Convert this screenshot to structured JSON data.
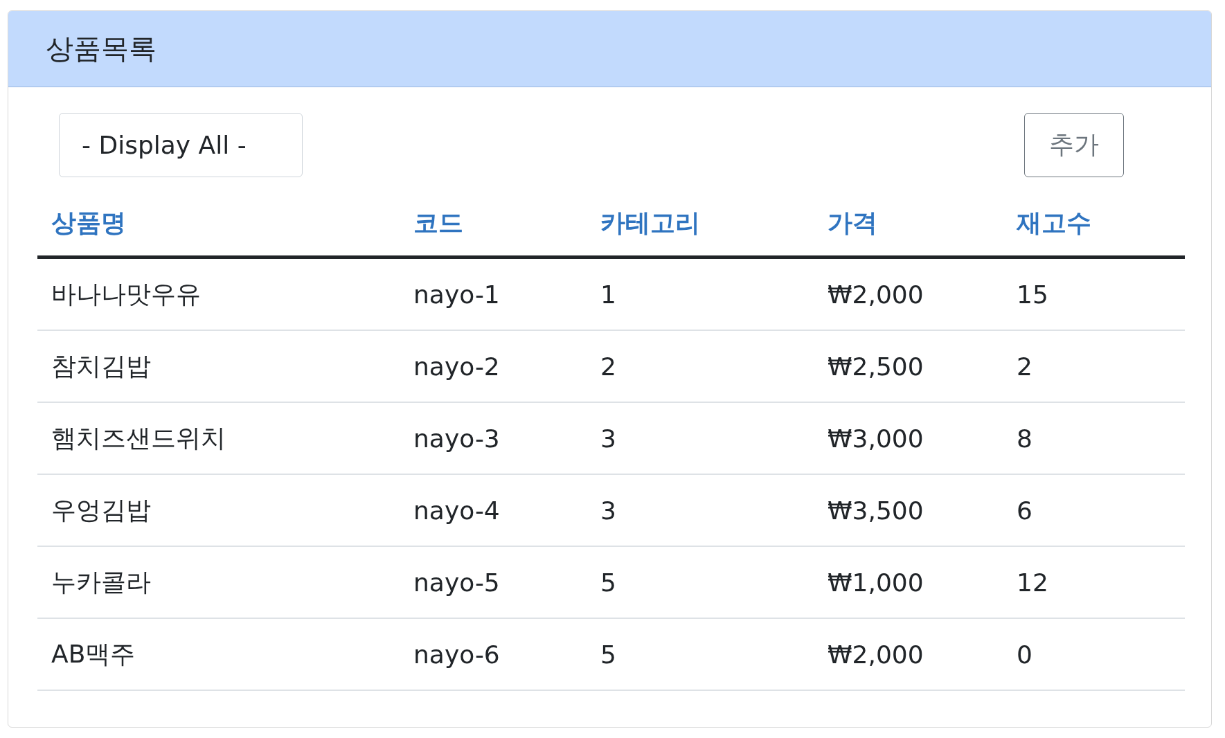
{
  "card": {
    "title": "상품목록"
  },
  "filter": {
    "value": "- Display All -"
  },
  "add_button": {
    "label": "추가"
  },
  "table": {
    "columns": [
      "상품명",
      "코드",
      "카테고리",
      "가격",
      "재고수"
    ],
    "rows": [
      [
        "바나나맛우유",
        "nayo-1",
        "1",
        "₩2,000",
        "15"
      ],
      [
        "참치김밥",
        "nayo-2",
        "2",
        "₩2,500",
        "2"
      ],
      [
        "햄치즈샌드위치",
        "nayo-3",
        "3",
        "₩3,000",
        "8"
      ],
      [
        "우엉김밥",
        "nayo-4",
        "3",
        "₩3,500",
        "6"
      ],
      [
        "누카콜라",
        "nayo-5",
        "5",
        "₩1,000",
        "12"
      ],
      [
        "AB맥주",
        "nayo-6",
        "5",
        "₩2,000",
        "0"
      ]
    ]
  }
}
